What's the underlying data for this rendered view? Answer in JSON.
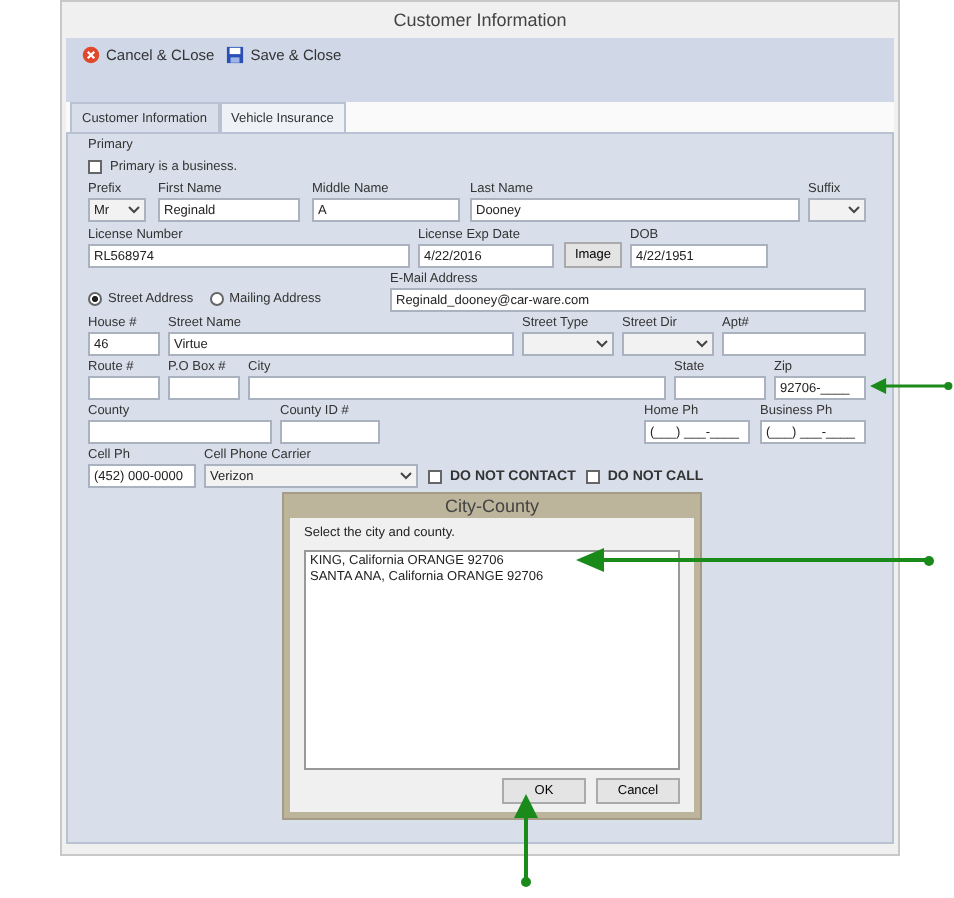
{
  "window": {
    "title": "Customer Information"
  },
  "toolbar": [
    {
      "kind": "cancel",
      "label": "Cancel & CLose"
    },
    {
      "kind": "save",
      "label": "Save & Close"
    }
  ],
  "tabs": [
    {
      "label": "Customer Information",
      "selected": true
    },
    {
      "label": "Vehicle Insurance",
      "selected": false
    }
  ],
  "section": "Primary",
  "business_checkbox": {
    "label": "Primary is a business.",
    "checked": false
  },
  "address_type": [
    {
      "label": "Street Address",
      "selected": true
    },
    {
      "label": "Mailing Address",
      "selected": false
    }
  ],
  "rows": [
    [
      {
        "kind": "select",
        "label": "Prefix",
        "value": "Mr"
      },
      {
        "kind": "text",
        "label": "First Name",
        "value": "Reginald"
      },
      {
        "kind": "text",
        "label": "Middle Name",
        "value": "A"
      },
      {
        "kind": "text",
        "label": "Last Name",
        "value": "Dooney"
      },
      {
        "kind": "select",
        "label": "Suffix"
      }
    ],
    [
      {
        "kind": "text",
        "label": "License Number",
        "value": "RL568974"
      },
      {
        "kind": "text",
        "label": "License Exp Date",
        "value": "4/22/2016"
      },
      {
        "kind": "button",
        "value": "Image"
      },
      {
        "kind": "text",
        "label": "DOB",
        "value": "4/22/1951"
      }
    ],
    [
      {
        "kind": "text",
        "label": "E-Mail Address",
        "value": "Reginald_dooney@car-ware.com"
      }
    ],
    [
      {
        "kind": "text",
        "label": "House #",
        "value": "46"
      },
      {
        "kind": "text",
        "label": "Street Name",
        "value": "Virtue"
      },
      {
        "kind": "select",
        "label": "Street Type"
      },
      {
        "kind": "select",
        "label": "Street Dir"
      },
      {
        "kind": "text",
        "label": "Apt#"
      }
    ],
    [
      {
        "kind": "text",
        "label": "Route #"
      },
      {
        "kind": "text",
        "label": "P.O Box #"
      },
      {
        "kind": "text",
        "label": "City"
      },
      {
        "kind": "text",
        "label": "State"
      },
      {
        "kind": "text",
        "label": "Zip",
        "value": "92706-____"
      }
    ],
    [
      {
        "kind": "text",
        "label": "County"
      },
      {
        "kind": "text",
        "label": "County ID #"
      },
      {
        "kind": "text",
        "label": "Home Ph",
        "value": "(___) ___-____"
      },
      {
        "kind": "text",
        "label": "Business Ph",
        "value": "(___) ___-____"
      }
    ],
    [
      {
        "kind": "text",
        "label": "Cell Ph",
        "value": "(452) 000-0000"
      },
      {
        "kind": "select",
        "label": "Cell Phone Carrier",
        "value": "Verizon"
      }
    ]
  ],
  "flags": [
    {
      "label": "DO NOT CONTACT",
      "checked": false
    },
    {
      "label": "DO NOT CALL",
      "checked": false
    }
  ],
  "dialog": {
    "title": "City-County",
    "prompt": "Select the city and county.",
    "items": [
      {
        "text": "KING, California ORANGE 92706",
        "selected": false
      },
      {
        "text": "SANTA ANA, California ORANGE 92706",
        "selected": false
      }
    ],
    "buttons": [
      "OK",
      "Cancel"
    ]
  }
}
